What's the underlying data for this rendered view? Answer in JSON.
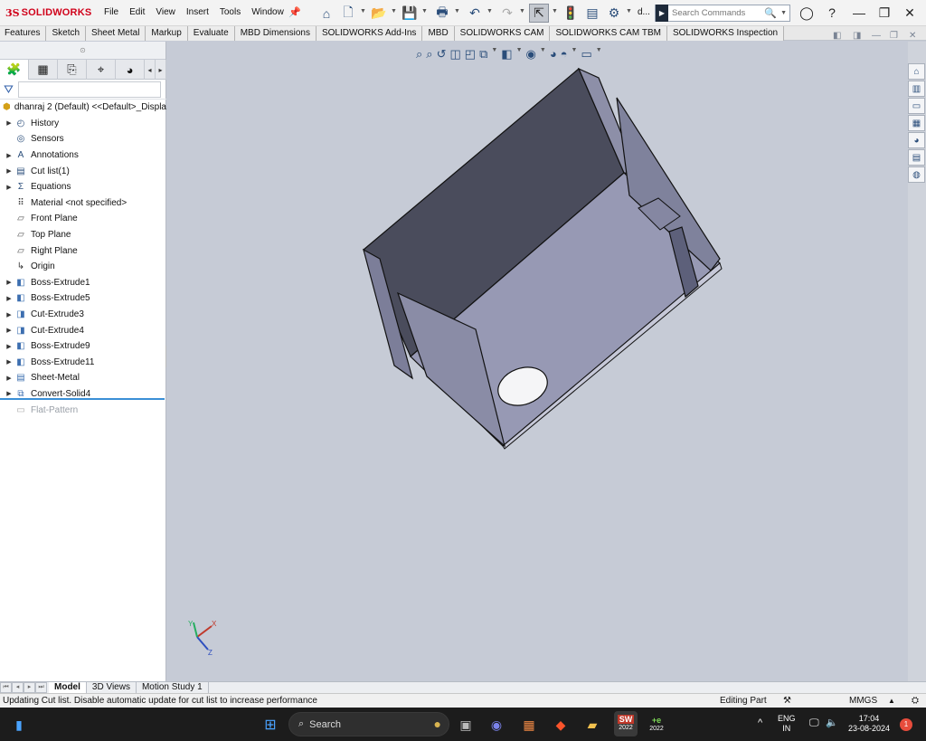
{
  "app": {
    "brand_ds": "3S",
    "brand_name": "SOLIDWORKS"
  },
  "menu": [
    "File",
    "Edit",
    "View",
    "Insert",
    "Tools",
    "Window"
  ],
  "toolbar": {
    "doc_short": "d..."
  },
  "search": {
    "placeholder": "Search Commands"
  },
  "command_tabs": [
    "Features",
    "Sketch",
    "Sheet Metal",
    "Markup",
    "Evaluate",
    "MBD Dimensions",
    "SOLIDWORKS Add-Ins",
    "MBD",
    "SOLIDWORKS CAM",
    "SOLIDWORKS CAM TBM",
    "SOLIDWORKS Inspection"
  ],
  "tree": {
    "root": "dhanraj 2 (Default) <<Default>_Displa",
    "items": [
      {
        "label": "History",
        "icon": "history-icon",
        "expand": true
      },
      {
        "label": "Sensors",
        "icon": "sensor-icon",
        "expand": false
      },
      {
        "label": "Annotations",
        "icon": "annotation-icon",
        "expand": true
      },
      {
        "label": "Cut list(1)",
        "icon": "cutlist-icon",
        "expand": true
      },
      {
        "label": "Equations",
        "icon": "equation-icon",
        "expand": true
      },
      {
        "label": "Material <not specified>",
        "icon": "material-icon",
        "expand": false
      },
      {
        "label": "Front Plane",
        "icon": "plane-icon",
        "expand": false
      },
      {
        "label": "Top Plane",
        "icon": "plane-icon",
        "expand": false
      },
      {
        "label": "Right Plane",
        "icon": "plane-icon",
        "expand": false
      },
      {
        "label": "Origin",
        "icon": "origin-icon",
        "expand": false
      },
      {
        "label": "Boss-Extrude1",
        "icon": "extrude-icon",
        "expand": true
      },
      {
        "label": "Boss-Extrude5",
        "icon": "extrude-icon",
        "expand": true
      },
      {
        "label": "Cut-Extrude3",
        "icon": "cut-icon",
        "expand": true
      },
      {
        "label": "Cut-Extrude4",
        "icon": "cut-icon",
        "expand": true
      },
      {
        "label": "Boss-Extrude9",
        "icon": "extrude-icon",
        "expand": true
      },
      {
        "label": "Boss-Extrude11",
        "icon": "extrude-icon",
        "expand": true
      },
      {
        "label": "Sheet-Metal",
        "icon": "sheetmetal-icon",
        "expand": true
      },
      {
        "label": "Convert-Solid4",
        "icon": "convert-icon",
        "expand": true
      },
      {
        "label": "Flat-Pattern",
        "icon": "flatpattern-icon",
        "expand": false
      }
    ]
  },
  "bottom_tabs": [
    "Model",
    "3D Views",
    "Motion Study 1"
  ],
  "status": {
    "message": "Updating Cut list. Disable automatic update for cut list to increase performance",
    "mode": "Editing Part",
    "units": "MMGS"
  },
  "triad": {
    "x": "X",
    "y": "Y",
    "z": "Z"
  },
  "taskbar": {
    "search": "Search",
    "lang1": "ENG",
    "lang2": "IN",
    "time": "17:04",
    "date": "23-08-2024",
    "notifications": "1",
    "sw_year": "2022",
    "ie_year": "2022"
  }
}
